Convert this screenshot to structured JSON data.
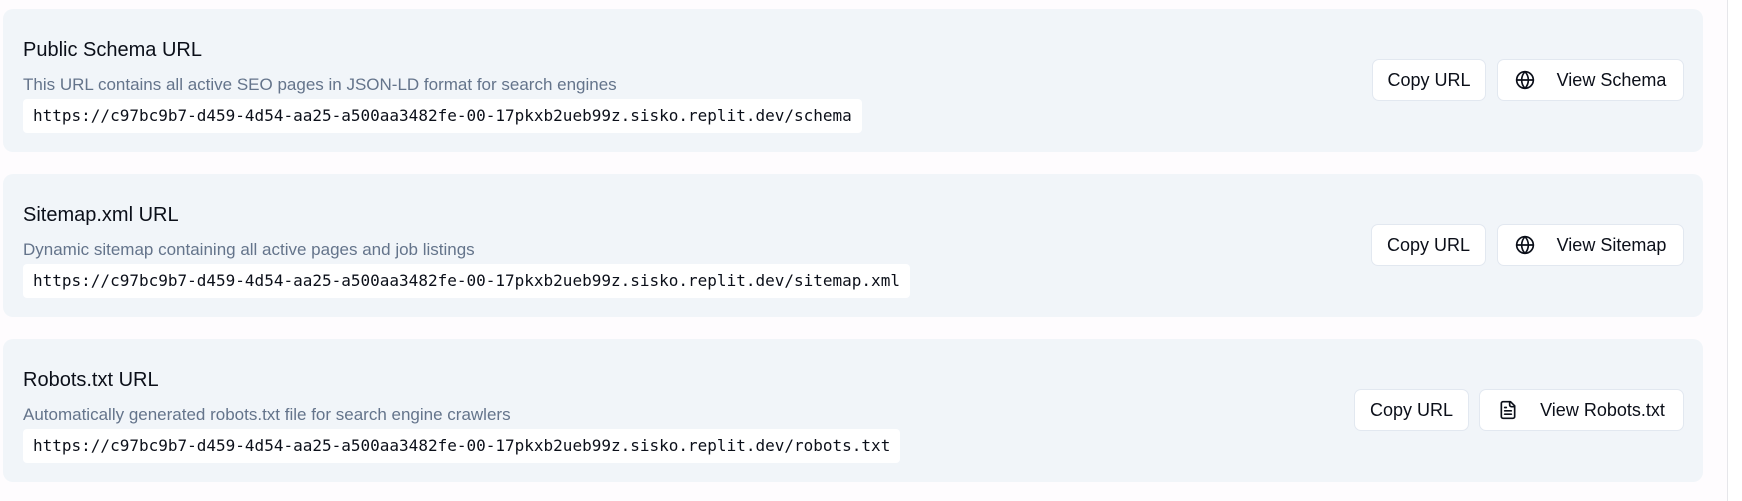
{
  "cards": [
    {
      "title": "Public Schema URL",
      "description": "This URL contains all active SEO pages in JSON-LD format for search engines",
      "url": "https://c97bc9b7-d459-4d54-aa25-a500aa3482fe-00-17pkxb2ueb99z.sisko.replit.dev/schema",
      "copy_label": "Copy URL",
      "view_label": "View Schema",
      "view_icon": "globe-icon"
    },
    {
      "title": "Sitemap.xml URL",
      "description": "Dynamic sitemap containing all active pages and job listings",
      "url": "https://c97bc9b7-d459-4d54-aa25-a500aa3482fe-00-17pkxb2ueb99z.sisko.replit.dev/sitemap.xml",
      "copy_label": "Copy URL",
      "view_label": "View Sitemap",
      "view_icon": "globe-icon"
    },
    {
      "title": "Robots.txt URL",
      "description": "Automatically generated robots.txt file for search engine crawlers",
      "url": "https://c97bc9b7-d459-4d54-aa25-a500aa3482fe-00-17pkxb2ueb99z.sisko.replit.dev/robots.txt",
      "copy_label": "Copy URL",
      "view_label": "View Robots.txt",
      "view_icon": "file-text-icon"
    }
  ],
  "colors": {
    "card_background": "#f1f5f9",
    "title_text": "#0b0f19",
    "muted_text": "#64748b",
    "button_border": "#e2e8f0"
  }
}
